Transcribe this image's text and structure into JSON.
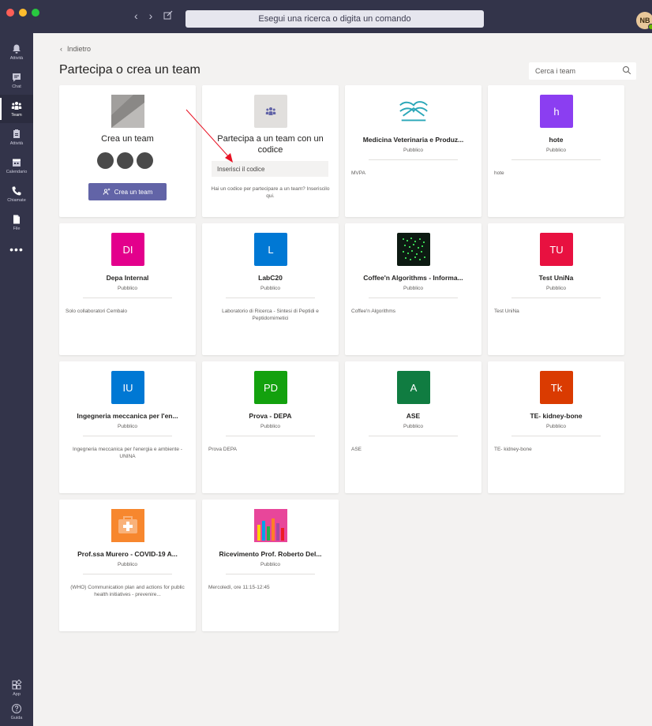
{
  "window": {
    "search_placeholder": "Esegui una ricerca o digita un comando",
    "avatar_initials": "NB",
    "traffic_colors": [
      "#ff5f57",
      "#febc2e",
      "#28c840"
    ]
  },
  "rail": {
    "items": [
      {
        "label": "Attività",
        "icon": "bell-icon"
      },
      {
        "label": "Chat",
        "icon": "chat-icon"
      },
      {
        "label": "Team",
        "icon": "team-icon"
      },
      {
        "label": "Attività",
        "icon": "activity-icon"
      },
      {
        "label": "Calendario",
        "icon": "calendar-icon"
      },
      {
        "label": "Chiamate",
        "icon": "phone-icon"
      },
      {
        "label": "File",
        "icon": "file-icon"
      }
    ],
    "more_label": "•••",
    "bottom": [
      {
        "label": "App",
        "icon": "apps-icon"
      },
      {
        "label": "Guida",
        "icon": "help-icon"
      }
    ]
  },
  "main": {
    "back_label": "Indietro",
    "title": "Partecipa o crea un team",
    "team_search_placeholder": "Cerca i team",
    "create_card": {
      "title": "Crea un team",
      "button_label": "Crea un team"
    },
    "join_card": {
      "title": "Partecipa a un team con un codice",
      "input_placeholder": "Inserisci il codice",
      "help_text": "Hai un codice per partecipare a un team? Inseriscilo qui."
    },
    "teams": [
      {
        "name": "Medicina Veterinaria e Produz...",
        "visibility": "Pubblico",
        "description": "MVPA",
        "initials": "",
        "color": "#ffffff"
      },
      {
        "name": "hote",
        "visibility": "Pubblico",
        "description": "hote",
        "initials": "h",
        "color": "#8b3ef1"
      },
      {
        "name": "Depa Internal",
        "visibility": "Pubblico",
        "description": "Solo collaboratori Cembalo",
        "initials": "DI",
        "color": "#e3008c"
      },
      {
        "name": "LabC20",
        "visibility": "Pubblico",
        "description": "Laboratorio di Ricerca - Sintesi di Peptidi e Peptidomimetici",
        "initials": "L",
        "color": "#0078d4"
      },
      {
        "name": "Coffee'n Algorithms - Informa...",
        "visibility": "Pubblico",
        "description": "Coffee'n Algorithms",
        "initials": "",
        "color": "#0d1a12"
      },
      {
        "name": "Test UniNa",
        "visibility": "Pubblico",
        "description": "Test UniNa",
        "initials": "TU",
        "color": "#e81140"
      },
      {
        "name": "Ingegneria meccanica per l'en...",
        "visibility": "Pubblico",
        "description": "Ingegneria meccanica per l'energia e ambiente - UNINA",
        "initials": "IU",
        "color": "#0078d4"
      },
      {
        "name": "Prova - DEPA",
        "visibility": "Pubblico",
        "description": "Prova DEPA",
        "initials": "PD",
        "color": "#13a10e"
      },
      {
        "name": "ASE",
        "visibility": "Pubblico",
        "description": "ASE",
        "initials": "A",
        "color": "#107c41"
      },
      {
        "name": "TE- kidney-bone",
        "visibility": "Pubblico",
        "description": "TE- kidney-bone",
        "initials": "Tk",
        "color": "#da3b01"
      },
      {
        "name": "Prof.ssa Murero - COVID-19 A...",
        "visibility": "Pubblico",
        "description": "(WHO) Communication plan and actions for public health initiatives - prevenire...",
        "initials": "",
        "color": "#f7872e"
      },
      {
        "name": "Ricevimento Prof. Roberto Del...",
        "visibility": "Pubblico",
        "description": "Mercoledì, ore 11:15-12:45",
        "initials": "",
        "color": "#e8469a"
      }
    ]
  }
}
